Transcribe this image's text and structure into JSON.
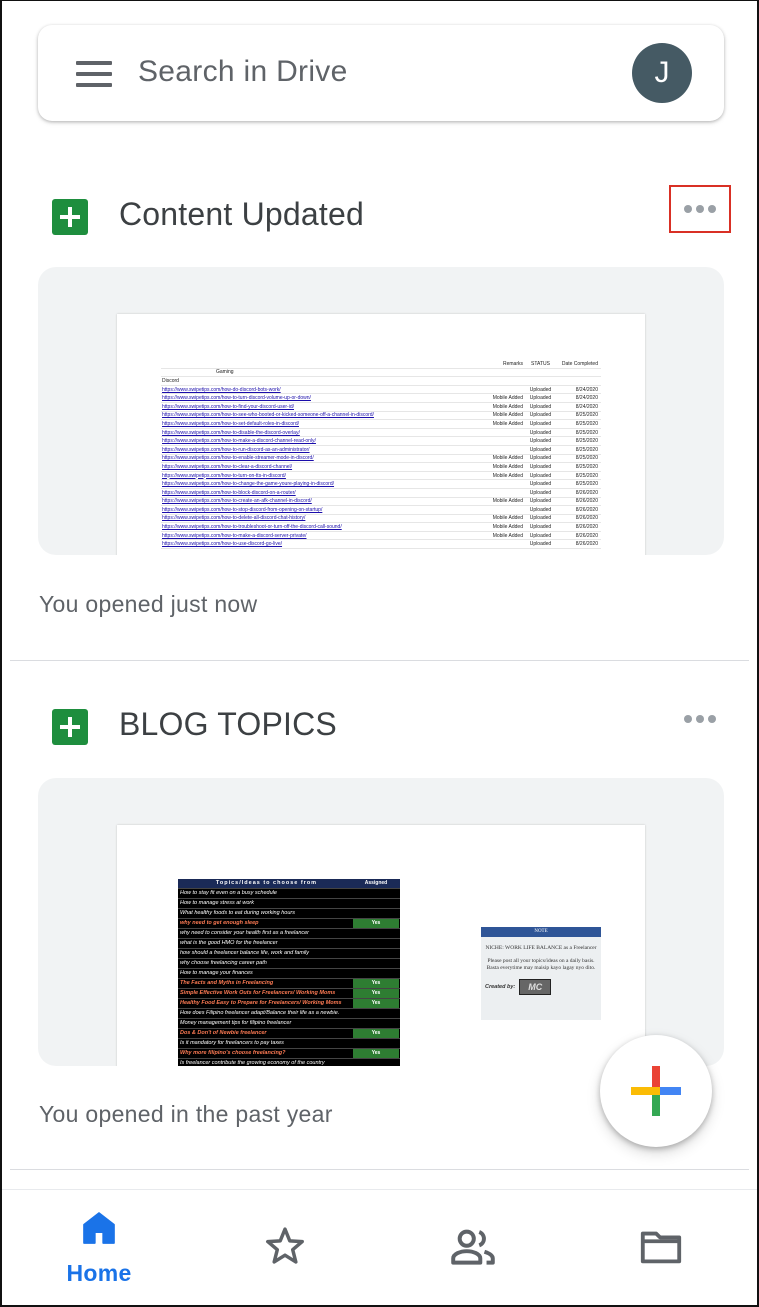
{
  "search": {
    "placeholder": "Search in Drive"
  },
  "account": {
    "initial": "J",
    "color": "#455a64"
  },
  "files": [
    {
      "title": "Content Updated",
      "icon": "google-sheets-icon",
      "opened": "You opened just now",
      "preview": {
        "header": {
          "col_a": "",
          "remarks": "Remarks",
          "status": "STATUS",
          "date": "Date Completed"
        },
        "category": "Gaming",
        "section": "Discord",
        "rows": [
          [
            "https://www.swipetips.com/how-do-discord-bots-work/",
            "",
            "Uploaded",
            "8/24/2020"
          ],
          [
            "https://www.swipetips.com/how-to-turn-discord-volume-up-or-down/",
            "Mobile Added",
            "Uploaded",
            "8/24/2020"
          ],
          [
            "https://www.swipetips.com/how-to-find-your-discord-user-id/",
            "Mobile Added",
            "Uploaded",
            "8/24/2020"
          ],
          [
            "https://www.swipetips.com/how-to-see-who-booted-or-kicked-someone-off-a-channel-in-discord/",
            "Mobile Added",
            "Uploaded",
            "8/25/2020"
          ],
          [
            "https://www.swipetips.com/how-to-set-default-roles-in-discord/",
            "Mobile Added",
            "Uploaded",
            "8/25/2020"
          ],
          [
            "https://www.swipetips.com/how-to-disable-the-discord-overlay/",
            "",
            "Uploaded",
            "8/25/2020"
          ],
          [
            "https://www.swipetips.com/how-to-make-a-discord-channel-read-only/",
            "",
            "Uploaded",
            "8/25/2020"
          ],
          [
            "https://www.swipetips.com/how-to-run-discord-as-an-administrator/",
            "",
            "Uploaded",
            "8/25/2020"
          ],
          [
            "https://www.swipetips.com/how-to-enable-streamer-mode-in-discord/",
            "Mobile Added",
            "Uploaded",
            "8/25/2020"
          ],
          [
            "https://www.swipetips.com/how-to-clear-a-discord-channel/",
            "Mobile Added",
            "Uploaded",
            "8/25/2020"
          ],
          [
            "https://www.swipetips.com/how-to-turn-on-tts-in-discord/",
            "Mobile Added",
            "Uploaded",
            "8/25/2020"
          ],
          [
            "https://www.swipetips.com/how-to-change-the-game-youre-playing-in-discord/",
            "",
            "Uploaded",
            "8/25/2020"
          ],
          [
            "https://www.swipetips.com/how-to-block-discord-on-a-router/",
            "",
            "Uploaded",
            "8/26/2020"
          ],
          [
            "https://www.swipetips.com/how-to-create-an-afk-channel-in-discord/",
            "Mobile Added",
            "Uploaded",
            "8/26/2020"
          ],
          [
            "https://www.swipetips.com/how-to-stop-discord-from-opening-on-startup/",
            "",
            "Uploaded",
            "8/26/2020"
          ],
          [
            "https://www.swipetips.com/how-to-delete-all-discord-chat-history/",
            "Mobile Added",
            "Uploaded",
            "8/26/2020"
          ],
          [
            "https://www.swipetips.com/how-to-troubleshoot-or-turn-off-the-discord-call-sound/",
            "Mobile Added",
            "Uploaded",
            "8/26/2020"
          ],
          [
            "https://www.swipetips.com/how-to-make-a-discord-server-private/",
            "Mobile Added",
            "Uploaded",
            "8/26/2020"
          ],
          [
            "https://www.swipetips.com/how-to-use-discord-go-live/",
            "",
            "Uploaded",
            "8/26/2020"
          ]
        ]
      }
    },
    {
      "title": "BLOG TOPICS",
      "icon": "google-sheets-icon",
      "opened": "You opened in the past year",
      "preview": {
        "header": {
          "topic": "Topics/Ideas to choose from",
          "assigned": "Assigned"
        },
        "rows": [
          {
            "text": "How to stay fit even on a busy schedule",
            "assigned": "",
            "hl": false
          },
          {
            "text": "How to manage stress at work",
            "assigned": "",
            "hl": false
          },
          {
            "text": "What healthy foods to eat during working hours",
            "assigned": "",
            "hl": false
          },
          {
            "text": "why need to get enough sleep",
            "assigned": "Yes",
            "hl": true
          },
          {
            "text": "why need to consider your health first as a freelancer",
            "assigned": "",
            "hl": false
          },
          {
            "text": "what is the good HMO for the freelancer",
            "assigned": "",
            "hl": false
          },
          {
            "text": "how should a freelancer balance life, work and family",
            "assigned": "",
            "hl": false
          },
          {
            "text": "why choose freelancing career path",
            "assigned": "",
            "hl": false
          },
          {
            "text": "How to manage your finances",
            "assigned": "",
            "hl": false
          },
          {
            "text": "The Facts and Myths in Freelancing",
            "assigned": "Yes",
            "hl": true
          },
          {
            "text": "Simple Effective Work Outs for Freelancers/ Working Moms",
            "assigned": "Yes",
            "hl": true
          },
          {
            "text": "Healthy Food Easy to Prepare for Freelancers/ Working Moms",
            "assigned": "Yes",
            "hl": true
          },
          {
            "text": "How does Filipino freelancer adapt/Balance their life as a newbie.",
            "assigned": "",
            "hl": false
          },
          {
            "text": "Money management tips for filipino freelancer",
            "assigned": "",
            "hl": false
          },
          {
            "text": "Dos & Don't of Newbie freelancer",
            "assigned": "Yes",
            "hl": true
          },
          {
            "text": "Is it mandatory for freelancers to pay taxes",
            "assigned": "",
            "hl": false
          },
          {
            "text": "Why more filipino's choose freelancing?",
            "assigned": "Yes",
            "hl": true
          },
          {
            "text": "Is freelancer contribute the growing economy of the country",
            "assigned": "",
            "hl": false
          }
        ],
        "note": {
          "heading": "NOTE",
          "niche": "NICHE: WORK LIFE BALANCE as a Freelancer",
          "body": "Please post all your topics/ideas on a daily basis. Basta everytime may maisip kayo lagay nyo dito.",
          "created_by": "Created by:",
          "logo": "MC"
        }
      }
    }
  ],
  "fab": {
    "icon": "new-plus-icon"
  },
  "bottom_nav": [
    {
      "label": "Home",
      "icon": "home-icon",
      "active": true
    },
    {
      "label": "",
      "icon": "star-icon",
      "active": false
    },
    {
      "label": "",
      "icon": "shared-people-icon",
      "active": false
    },
    {
      "label": "",
      "icon": "folder-icon",
      "active": false
    }
  ],
  "colors": {
    "accent": "#1a73e8",
    "sheets_green": "#1e8e3e",
    "highlight_border": "#d93025"
  }
}
